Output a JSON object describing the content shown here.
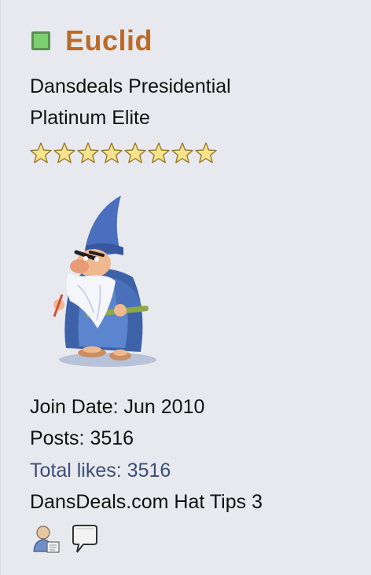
{
  "user": {
    "name": "Euclid",
    "online_status_color": "#7ccf6d",
    "title_line1": "Dansdeals Presidential",
    "title_line2": "Platinum Elite",
    "rank_stars": 8
  },
  "stats": {
    "join_label": "Join Date:",
    "join_value": "Jun 2010",
    "posts_label": "Posts:",
    "posts_value": "3516",
    "likes_label": "Total likes:",
    "likes_value": "3516",
    "hat_tips_label": "DansDeals.com Hat Tips",
    "hat_tips_value": "3"
  },
  "icons": [
    "user-profile-icon",
    "speech-bubble-icon"
  ],
  "colors": {
    "username": "#b86b2c",
    "likes": "#3b4e78",
    "background": "#e8e9ee"
  }
}
